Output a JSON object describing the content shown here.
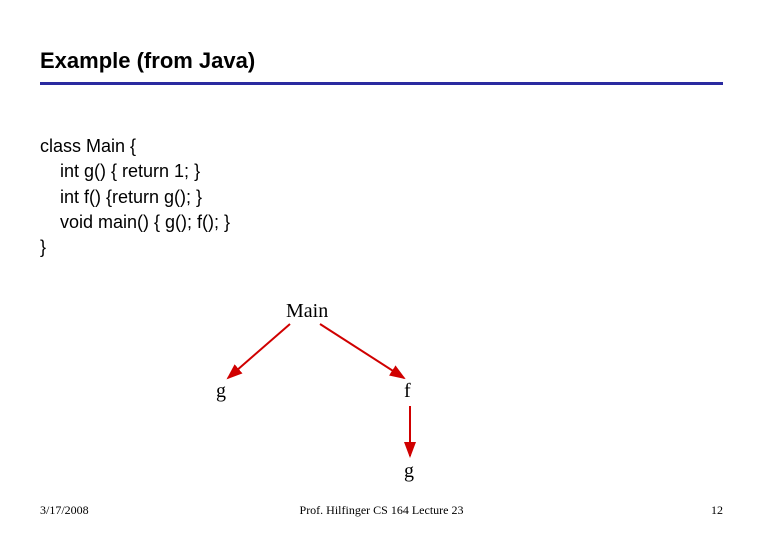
{
  "title": "Example (from Java)",
  "code": {
    "l1": "class Main {",
    "l2": "    int g() { return 1; }",
    "l3": "    int f() {return g(); }",
    "l4": "    void main() { g(); f(); }",
    "l5": "}"
  },
  "diagram": {
    "main": "Main",
    "g1": "g",
    "f": "f",
    "g2": "g",
    "arrow_color": "#d00000"
  },
  "footer": {
    "date": "3/17/2008",
    "center": "Prof. Hilfinger  CS 164  Lecture 23",
    "page": "12"
  }
}
